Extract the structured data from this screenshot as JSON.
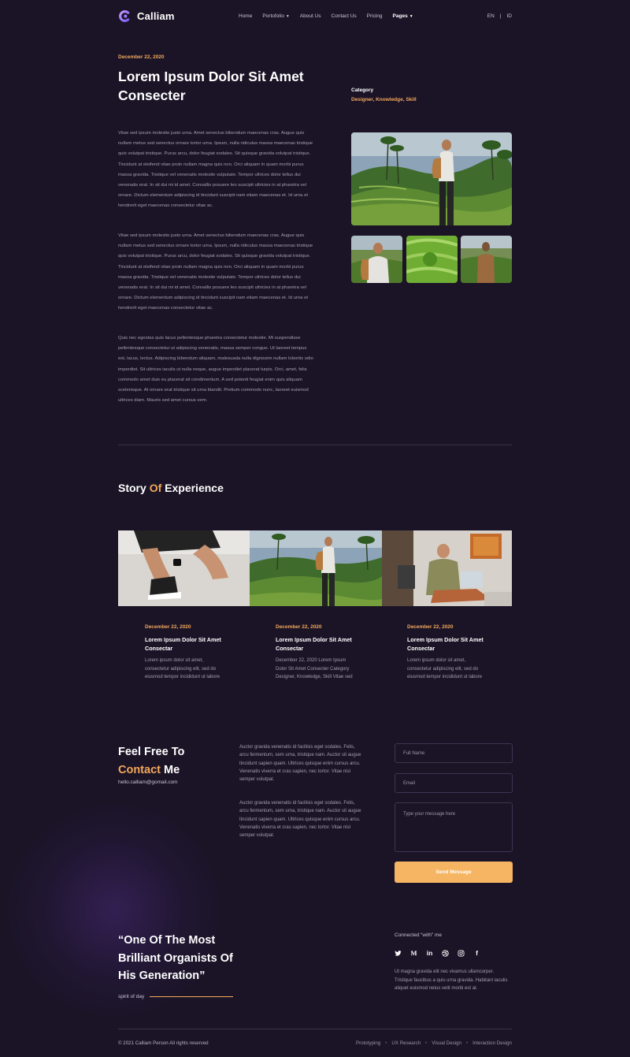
{
  "nav": {
    "brand": "Calliam",
    "items": [
      {
        "label": "Home"
      },
      {
        "label": "Portofolio"
      },
      {
        "label": "About Us"
      },
      {
        "label": "Contact Us"
      },
      {
        "label": "Pricing"
      },
      {
        "label": "Pages"
      }
    ],
    "lang_en": "EN",
    "lang_sep": "|",
    "lang_id": "ID"
  },
  "hero": {
    "date": "December 22, 2020",
    "title": "Lorem Ipsum Dolor Sit Amet Consecter",
    "category_label": "Category",
    "category_value": "Designer, Knowledge, Skill"
  },
  "body": {
    "p1": "Vitae sed ipsum molestie justo urna. Amet senectus bibendum maecenas cras. Augue quis nullam metus sed senectus ornare tortor urna. Ipsum, nulla ridiculus massa maecenas tristique quis volutpat tristique. Purus arcu, dolor feugiat sodales. Sit quisque gravida volutpat tristique. Tincidunt at eleifend vitae proin nullam magna quis non. Orci aliquam in quam morbi purus massa gravida. Tristique vel venenatis molestie vulputate. Tempor ultrices dolor tellus dui venenatis erat. In sit dui mi id amet. Convallis posuere leo suscipit ultricies in at pharetra vel ornare. Dictum elementum adipiscing id tincidunt suscipit nam etiam maecenas et. Id urna et hendrerit eget maecenas consectetur vitae ac.",
    "p2": "Vitae sed ipsum molestie justo urna. Amet senectus bibendum maecenas cras. Augue quis nullam metus sed senectus ornare tortor urna. Ipsum, nulla ridiculus massa maecenas tristique quis volutpat tristique. Purus arcu, dolor feugiat sodales. Sit quisque gravida volutpat tristique. Tincidunt at eleifend vitae proin nullam magna quis non. Orci aliquam in quam morbi purus massa gravida. Tristique vel venenatis molestie vulputate. Tempor ultrices dolor tellus dui venenatis erat. In sit dui mi id amet. Convallis posuere leo suscipit ultricies in at pharetra vel ornare. Dictum elementum adipiscing id tincidunt suscipit nam etiam maecenas et. Id urna et hendrerit eget maecenas consectetur vitae ac.",
    "p3": "Quis nec egestas quis lacus pellentesque pharetra consectetur molestie. Mi suspendisse pellentesque consectetur ut adipiscing venenatis, massa semper congue. Ut laoreet tempus est, lacus, lectus. Adipiscing bibendum aliquam, malesuada nulla dignissim nullam lobortis odio imperdiet. Sit ultrices iaculis ut nulla neque, augue imperdiet placerat turpis. Orci, amet, felis commodo amet duis eu placerat sit condimentum. A sed potenti feugiat enim quis aliquam scelerisque. At ornare erat tristique sit urna blandit. Pretium commodo nunc, laoreet euismod ultrices diam. Mauris sed amet cursus sem."
  },
  "story": {
    "title_1": "Story",
    "title_2": "Of",
    "title_3": "Experience",
    "cards": [
      {
        "date": "December 22, 2020",
        "title": "Lorem Ipsum Dolor Sit Amet Consectar",
        "text": "Lorem ipsum dolor sit amet, consectetur adipiscing elit, sed do eiusmod tempor incididunt ut labore"
      },
      {
        "date": "December 22, 2020",
        "title": "Lorem Ipsum Dolor Sit Amet Consectar",
        "text": "December 22, 2020 Lorem Ipsum Dolor Sit Amet Consecter Category Designer, Knowledge, Skill Vitae sed"
      },
      {
        "date": "December 22, 2020",
        "title": "Lorem Ipsum Dolor Sit Amet Consectar",
        "text": "Lorem ipsum dolor sit amet, consectetur adipiscing elit, sed do eiusmod tempor incididunt ut labore"
      }
    ]
  },
  "contact": {
    "title_1": "Feel Free To",
    "title_2": "Contact",
    "title_3": "Me",
    "email": "hello.calliam@gomail.com",
    "text_1": "Auctor gravida venenatis id facilisis eget sodales. Felis, arcu fermentum, sem urna, tristique nam. Auctor sit augue tincidunt sapien quam. Ultrices quisque enim cursus arcu. Venenatis viverra et cras sapien, nec tortor. Vitae nisl semper volutpat.",
    "text_2": "Auctor gravida venenatis id facilisis eget sodales. Felis, arcu fermentum, sem urna, tristique nam. Auctor sit augue tincidunt sapien quam. Ultrices quisque enim cursus arcu. Venenatis viverra et cras sapien, nec tortor. Vitae nisl semper volutpat.",
    "full_name_placeholder": "Full Name",
    "email_placeholder": "Email",
    "message_placeholder": "Type your message here",
    "send_label": "Send Message"
  },
  "quote": {
    "text": "“One Of The Most Brilliant Organists Of His Generation”",
    "spirit": "spirit of day"
  },
  "social": {
    "connected": "Connected “with” me",
    "medium_glyph": "M",
    "linkedin_glyph": "in",
    "facebook_glyph": "f",
    "text": "Ut magna gravida elit nec vivamus ullamcorper. Tristique faucibus a quis urna gravida. Habitant iaculis aliquet euismod netus velit morbi est at."
  },
  "footer": {
    "copyright": "© 2021 Calliam Person All rights reserved",
    "links": [
      "Prototyping",
      "UX Research",
      "Visual Design",
      "Interaction Design"
    ]
  },
  "colors": {
    "background": "#1b1427",
    "accent": "#f2a85a",
    "button": "#f6b562"
  },
  "icons": [
    "logo-icon",
    "chevron-down-icon",
    "twitter-icon",
    "medium-icon",
    "linkedin-icon",
    "dribbble-icon",
    "instagram-icon",
    "facebook-icon"
  ]
}
